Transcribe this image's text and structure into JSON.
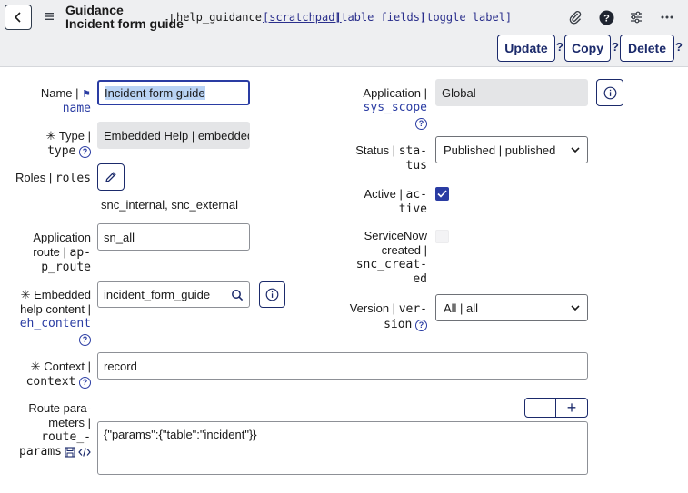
{
  "header": {
    "title_line1": "Guidance",
    "title_line2": "Incident form guide",
    "separator": "|",
    "table_name": "help_guidance",
    "links": [
      "[scratchpad]",
      "[table fields]",
      "[toggle label]"
    ],
    "icons": [
      "paperclip-icon",
      "help-icon",
      "sliders-icon",
      "more-icon"
    ],
    "buttons": {
      "update": "Update",
      "copy": "Copy",
      "delete": "Delete"
    },
    "button_help": "?"
  },
  "fields": {
    "name": {
      "label": "Name |",
      "field": "name",
      "value": "Incident form guide"
    },
    "type": {
      "mandatory": "✳",
      "label": "Type |",
      "field": "type",
      "value": "Embedded Help | embedded"
    },
    "roles": {
      "label": "Roles |",
      "field": "roles",
      "value": "snc_internal, snc_external"
    },
    "app_route": {
      "label_line1": "Application",
      "label_line2": "route |",
      "field_part1": "ap-",
      "field_part2": "p_route",
      "value": "sn_all"
    },
    "eh_content": {
      "mandatory": "✳",
      "label_line1": "Embedded",
      "label_line2": "help content |",
      "field": "eh_content",
      "value": "incident_form_guide"
    },
    "context": {
      "mandatory": "✳",
      "label": "Context |",
      "field": "context",
      "value": "record"
    },
    "route_params": {
      "label_line1": "Route para-",
      "label_line2": "meters |",
      "field_part1": "route_-",
      "field_part2": "params",
      "value": "{\"params\":{\"table\":\"incident\"}}",
      "minus": "—",
      "plus": "+"
    },
    "application": {
      "label": "Application |",
      "field": "sys_scope",
      "value": "Global"
    },
    "status": {
      "label": "Status |",
      "field_part1": "sta-",
      "field_part2": "tus",
      "value": "Published | published"
    },
    "active": {
      "label": "Active |",
      "field_part1": "ac-",
      "field_part2": "tive",
      "checked": true
    },
    "created": {
      "label_line1": "ServiceNow",
      "label_line2": "created |",
      "field_part1": "snc_creat-",
      "field_part2": "ed",
      "checked": false
    },
    "version": {
      "label": "Version |",
      "field_part1": "ver-",
      "field_part2": "sion",
      "value": "All | all"
    }
  },
  "help_glyph": "?"
}
